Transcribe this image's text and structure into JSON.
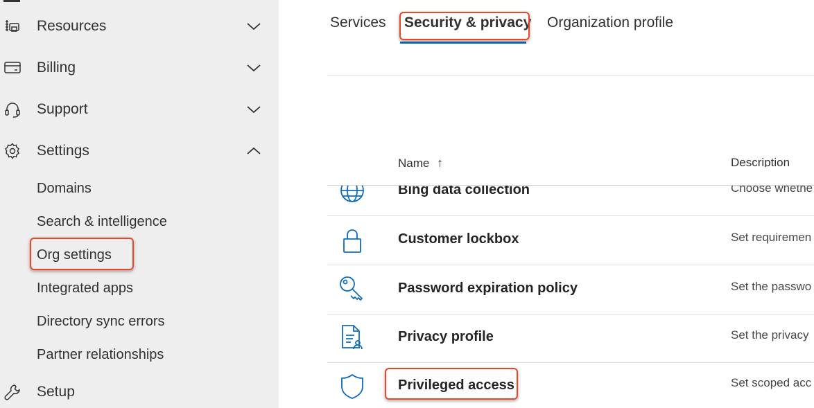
{
  "sidebar": {
    "items": [
      {
        "label": "Resources",
        "icon": "resources-icon",
        "chevron": "chevron-down-icon"
      },
      {
        "label": "Billing",
        "icon": "billing-card-icon",
        "chevron": "chevron-down-icon"
      },
      {
        "label": "Support",
        "icon": "headset-icon",
        "chevron": "chevron-down-icon"
      },
      {
        "label": "Settings",
        "icon": "gear-icon",
        "chevron": "chevron-up-icon"
      },
      {
        "label": "Setup",
        "icon": "wrench-icon"
      }
    ],
    "settings_sub": [
      {
        "label": "Domains"
      },
      {
        "label": "Search & intelligence"
      },
      {
        "label": "Org settings"
      },
      {
        "label": "Integrated apps"
      },
      {
        "label": "Directory sync errors"
      },
      {
        "label": "Partner relationships"
      }
    ]
  },
  "tabs": [
    {
      "label": "Services"
    },
    {
      "label": "Security & privacy"
    },
    {
      "label": "Organization profile"
    }
  ],
  "table": {
    "columns": {
      "name": "Name",
      "sort": "↑",
      "description": "Description"
    },
    "rows": [
      {
        "name": "Bing data collection",
        "description": "Choose whethe",
        "icon": "globe-icon"
      },
      {
        "name": "Customer lockbox",
        "description": "Set requiremen",
        "icon": "lock-icon"
      },
      {
        "name": "Password expiration policy",
        "description": "Set the passwo",
        "icon": "key-icon"
      },
      {
        "name": "Privacy profile",
        "description": "Set the privacy",
        "icon": "document-person-icon"
      },
      {
        "name": "Privileged access",
        "description": "Set scoped acc",
        "icon": "shield-icon"
      }
    ]
  },
  "colors": {
    "accent": "#0f6cbd",
    "highlight": "#e8472a",
    "sidebar_bg": "#eeeeee"
  }
}
